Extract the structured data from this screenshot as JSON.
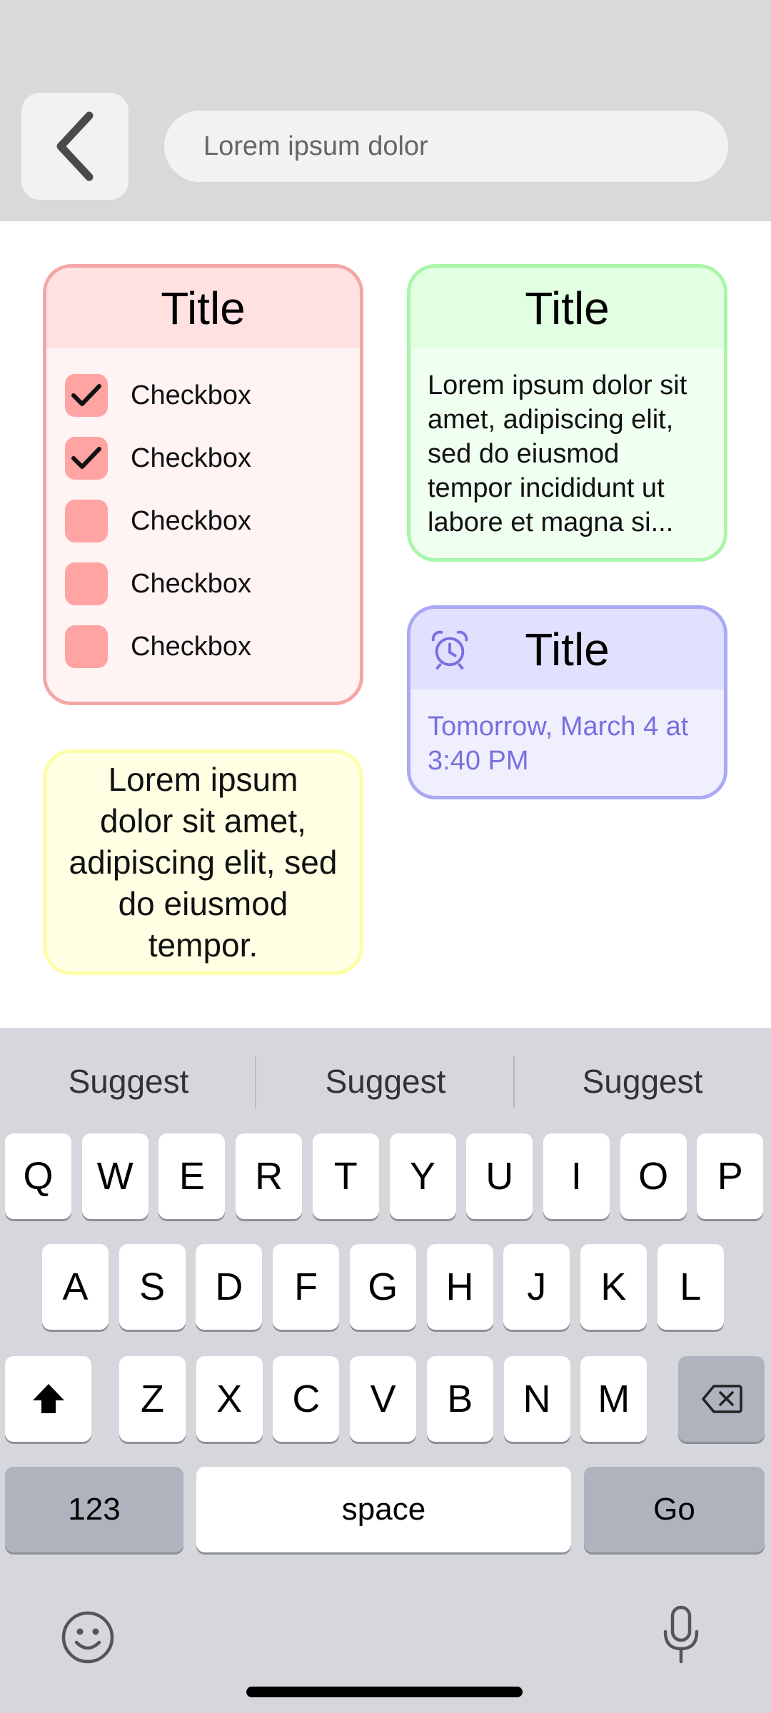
{
  "header": {
    "back_icon": "chevron-left-icon",
    "search_placeholder": "Lorem ipsum dolor"
  },
  "checklist_card": {
    "title": "Title",
    "items": [
      {
        "label": "Checkbox",
        "checked": true
      },
      {
        "label": "Checkbox",
        "checked": true
      },
      {
        "label": "Checkbox",
        "checked": false
      },
      {
        "label": "Checkbox",
        "checked": false
      },
      {
        "label": "Checkbox",
        "checked": false
      }
    ],
    "accent": "#ffa3a3"
  },
  "text_card": {
    "title": "Title",
    "body": "Lorem ipsum dolor sit amet, adipiscing elit, sed do eiusmod tempor incididunt ut labore et magna si...",
    "accent": "#a9f5a9"
  },
  "reminder_card": {
    "title": "Title",
    "icon": "alarm-clock-icon",
    "time": "Tomorrow, March 4 at 3:40 PM",
    "accent": "#7a6fe0"
  },
  "note_card": {
    "body": "Lorem ipsum dolor sit amet, adipiscing elit, sed do eiusmod tempor.",
    "accent": "#fdfda8"
  },
  "keyboard": {
    "suggestions": [
      "Suggest",
      "Suggest",
      "Suggest"
    ],
    "row1": [
      "Q",
      "W",
      "E",
      "R",
      "T",
      "Y",
      "U",
      "I",
      "O",
      "P"
    ],
    "row2": [
      "A",
      "S",
      "D",
      "F",
      "G",
      "H",
      "J",
      "K",
      "L"
    ],
    "row3": [
      "Z",
      "X",
      "C",
      "V",
      "B",
      "N",
      "M"
    ],
    "numbers_label": "123",
    "space_label": "space",
    "go_label": "Go",
    "shift_icon": "shift-icon",
    "backspace_icon": "backspace-icon",
    "emoji_icon": "emoji-icon",
    "mic_icon": "microphone-icon"
  }
}
